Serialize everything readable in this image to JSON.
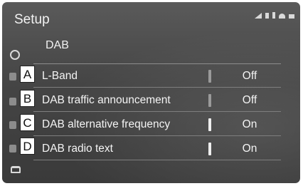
{
  "header": {
    "title": "Setup"
  },
  "section": {
    "title": "DAB"
  },
  "rows": [
    {
      "callout": "A",
      "label": "L-Band",
      "value": "Off",
      "state": "off"
    },
    {
      "callout": "B",
      "label": "DAB traffic announcement",
      "value": "Off",
      "state": "off"
    },
    {
      "callout": "C",
      "label": "DAB alternative frequency",
      "value": "On",
      "state": "on"
    },
    {
      "callout": "D",
      "label": "DAB radio text",
      "value": "On",
      "state": "on"
    }
  ],
  "icons": {
    "status": [
      "signal-icon",
      "battery-icon",
      "bluetooth-icon",
      "wifi-icon",
      "car-icon"
    ],
    "rail": [
      "gear-icon",
      "car-settings-icon"
    ]
  }
}
